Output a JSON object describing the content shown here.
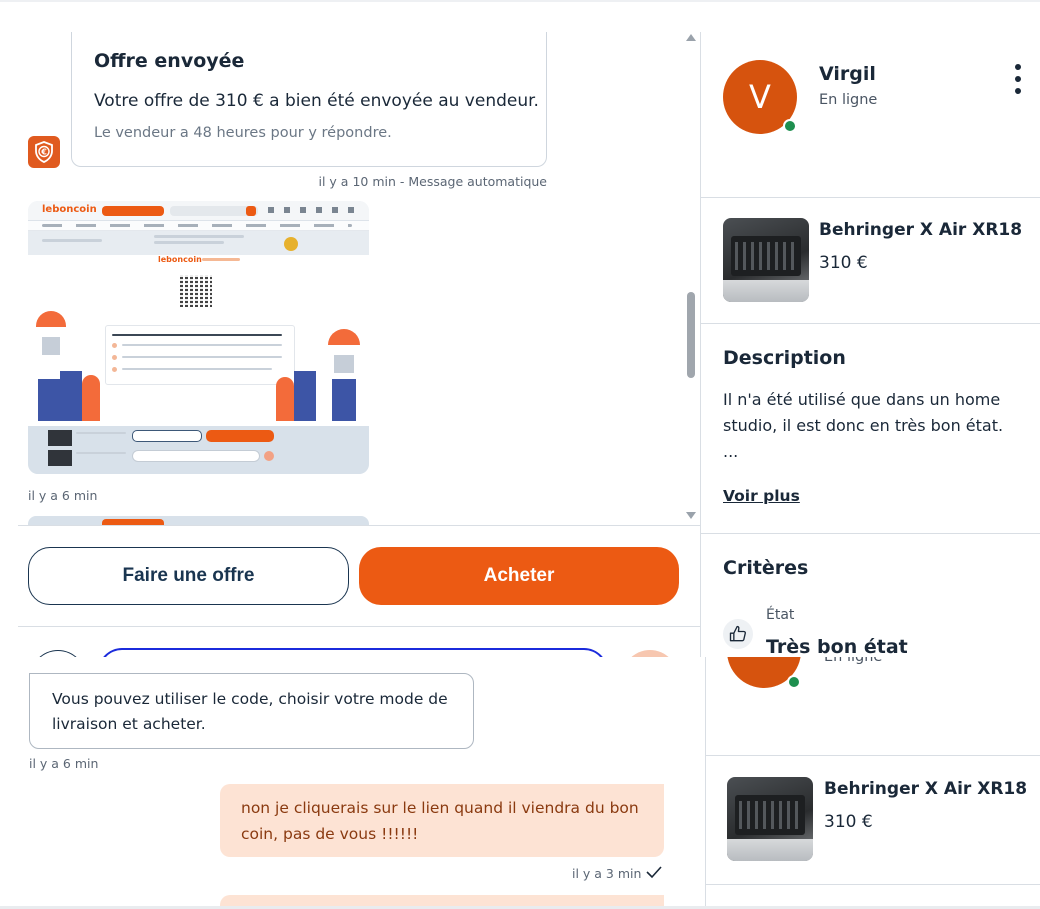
{
  "offer_card": {
    "title": "Offre envoyée",
    "text": "Votre offre de 310 € a bien été envoyée au vendeur.",
    "subtext": "Le vendeur a 48 heures pour y répondre.",
    "meta": "il y a 10 min - Message automatique"
  },
  "image_message": {
    "brand": "leboncoin",
    "meta": "il y a 6 min"
  },
  "actions": {
    "offer_label": "Faire une offre",
    "buy_label": "Acheter"
  },
  "seller": {
    "initial": "V",
    "name": "Virgil",
    "status": "En ligne"
  },
  "product": {
    "name": "Behringer X Air XR18",
    "price": "310 €"
  },
  "description": {
    "title": "Description",
    "text": "Il n'a été utilisé que dans un home studio, il est donc en très bon état.",
    "ellipsis": "...",
    "more_label": "Voir plus"
  },
  "criteria": {
    "title": "Critères",
    "label": "État",
    "value": "Très bon état"
  },
  "lower": {
    "seller_status": "En ligne",
    "incoming_text": "Vous pouvez utiliser le code, choisir votre mode de livraison et acheter.",
    "incoming_meta": "il y a 6 min",
    "outgoing_text": "non je cliquerais sur le lien quand il viendra du bon coin, pas de vous !!!!!!",
    "outgoing_meta": "il y a 3 min",
    "product_name": "Behringer X Air XR18",
    "product_price": "310 €"
  },
  "colors": {
    "accent": "#ec5a13",
    "navy": "#1a3550",
    "online": "#1e8f4f",
    "outgoing_bubble": "#fde3d4"
  }
}
